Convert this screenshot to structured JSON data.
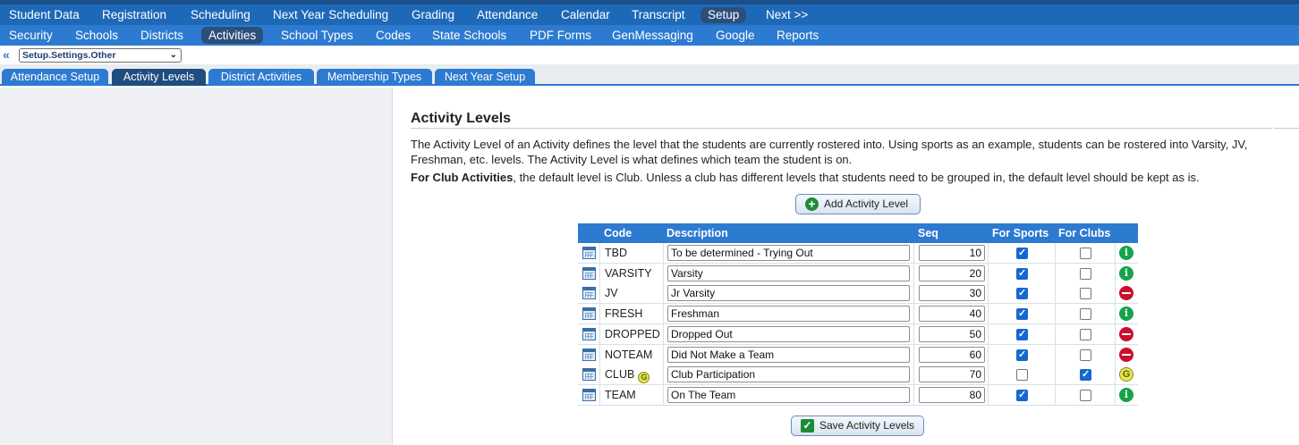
{
  "top_nav": [
    {
      "label": "Student Data",
      "active": false
    },
    {
      "label": "Registration",
      "active": false
    },
    {
      "label": "Scheduling",
      "active": false
    },
    {
      "label": "Next Year Scheduling",
      "active": false
    },
    {
      "label": "Grading",
      "active": false
    },
    {
      "label": "Attendance",
      "active": false
    },
    {
      "label": "Calendar",
      "active": false
    },
    {
      "label": "Transcript",
      "active": false
    },
    {
      "label": "Setup",
      "active": true
    },
    {
      "label": "Next >>",
      "active": false
    }
  ],
  "sub_nav": [
    {
      "label": "Security",
      "active": false
    },
    {
      "label": "Schools",
      "active": false
    },
    {
      "label": "Districts",
      "active": false
    },
    {
      "label": "Activities",
      "active": true
    },
    {
      "label": "School Types",
      "active": false
    },
    {
      "label": "Codes",
      "active": false
    },
    {
      "label": "State Schools",
      "active": false
    },
    {
      "label": "PDF Forms",
      "active": false
    },
    {
      "label": "GenMessaging",
      "active": false
    },
    {
      "label": "Google",
      "active": false
    },
    {
      "label": "Reports",
      "active": false
    }
  ],
  "breadcrumb": {
    "collapse_icon": "double-chevron-left-icon",
    "select_value": "Setup.Settings.Other"
  },
  "tabs": [
    {
      "label": "Attendance Setup",
      "active": false
    },
    {
      "label": "Activity Levels",
      "active": true
    },
    {
      "label": "District Activities",
      "active": false
    },
    {
      "label": "Membership Types",
      "active": false
    },
    {
      "label": "Next Year Setup",
      "active": false
    }
  ],
  "main": {
    "title": "Activity Levels",
    "description": "The Activity Level of an Activity defines the level that the students are currently rostered into. Using sports as an example, students can be rostered into Varsity, JV, Freshman, etc. levels. The Activity Level is what defines which team the student is on.",
    "club_note_bold": "For Club Activities",
    "club_note_rest": ", the default level is Club. Unless a club has different levels that students need to be grouped in, the default level should be kept as is.",
    "add_button_label": "Add Activity Level",
    "save_button_label": "Save Activity Levels"
  },
  "table": {
    "headers": {
      "code": "Code",
      "description": "Description",
      "seq": "Seq",
      "for_sports": "For Sports",
      "for_clubs": "For Clubs"
    },
    "rows": [
      {
        "code": "TBD",
        "description": "To be determined - Trying Out",
        "seq": "10",
        "for_sports": true,
        "for_clubs": false,
        "status": "info",
        "club_badge": false
      },
      {
        "code": "VARSITY",
        "description": "Varsity",
        "seq": "20",
        "for_sports": true,
        "for_clubs": false,
        "status": "info",
        "club_badge": false
      },
      {
        "code": "JV",
        "description": "Jr Varsity",
        "seq": "30",
        "for_sports": true,
        "for_clubs": false,
        "status": "stop",
        "club_badge": false
      },
      {
        "code": "FRESH",
        "description": "Freshman",
        "seq": "40",
        "for_sports": true,
        "for_clubs": false,
        "status": "info",
        "club_badge": false
      },
      {
        "code": "DROPPED",
        "description": "Dropped Out",
        "seq": "50",
        "for_sports": true,
        "for_clubs": false,
        "status": "stop",
        "club_badge": false
      },
      {
        "code": "NOTEAM",
        "description": "Did Not Make a Team",
        "seq": "60",
        "for_sports": true,
        "for_clubs": false,
        "status": "stop",
        "club_badge": false
      },
      {
        "code": "CLUB",
        "description": "Club Participation",
        "seq": "70",
        "for_sports": false,
        "for_clubs": true,
        "status": "club",
        "club_badge": true
      },
      {
        "code": "TEAM",
        "description": "On The Team",
        "seq": "80",
        "for_sports": true,
        "for_clubs": false,
        "status": "info",
        "club_badge": false
      }
    ]
  },
  "colors": {
    "nav_primary": "#1e69b7",
    "nav_secondary": "#2d7ad1",
    "active_tab": "#1f4d80",
    "info_green": "#15a34a",
    "stop_red": "#c8102e"
  }
}
